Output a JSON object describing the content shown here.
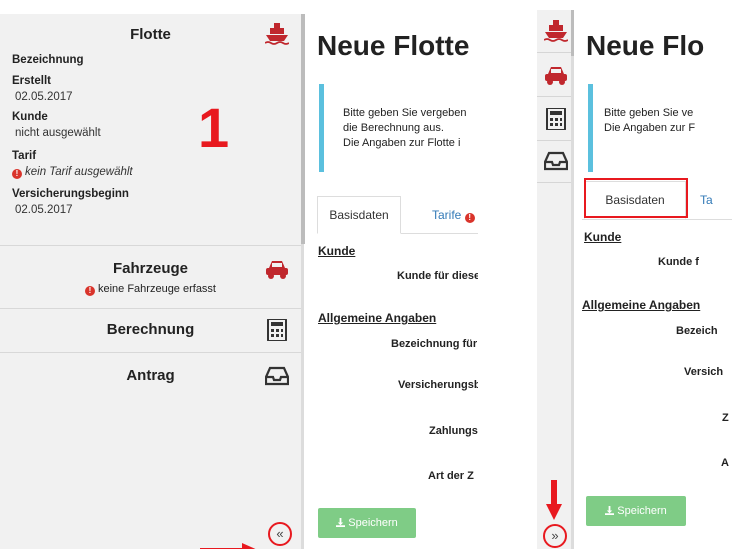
{
  "panel1": {
    "flotte": {
      "title": "Flotte",
      "icon": "ship-icon",
      "bezeichnung_label": "Bezeichnung",
      "erstellt_label": "Erstellt",
      "erstellt_value": "02.05.2017",
      "kunde_label": "Kunde",
      "kunde_value": "nicht ausgewählt",
      "tarif_label": "Tarif",
      "tarif_value": "kein Tarif ausgewählt",
      "vb_label": "Versicherungsbeginn",
      "vb_value": "02.05.2017"
    },
    "annotation_number": "1",
    "fahrzeuge": {
      "title": "Fahrzeuge",
      "warning": "keine Fahrzeuge erfasst",
      "icon": "car-icon"
    },
    "berechnung": {
      "title": "Berechnung",
      "icon": "calculator-icon"
    },
    "antrag": {
      "title": "Antrag",
      "icon": "inbox-icon"
    },
    "collapse_glyph": "«"
  },
  "content": {
    "page_title": "Neue Flotte",
    "info_line1": "Bitte geben Sie vergeben",
    "info_line2": "die Berechnung aus.",
    "info_line3": "Die Angaben zur Flotte i",
    "tab_basis": "Basisdaten",
    "tab_tarife": "Tarife",
    "section_kunde": "Kunde",
    "label_kunde": "Kunde für diese",
    "section_allgemein": "Allgemeine Angaben",
    "label_bez": "Bezeichnung für",
    "label_vers": "Versicherungsb",
    "label_zahlung": "Zahlungs",
    "label_art": "Art der Z",
    "save": "Speichern"
  },
  "panel2": {
    "page_title": "Neue Flo",
    "info_line1": "Bitte geben Sie ve",
    "info_line2": "Die Angaben zur F",
    "tab_basis": "Basisdaten",
    "tab_tarife": "Ta",
    "section_kunde": "Kunde",
    "label_kunde": "Kunde f",
    "section_allgemein": "Allgemeine Angaben",
    "label_bez": "Bezeich",
    "label_vers": "Versich",
    "label_zahlung": "Z",
    "label_art": "A",
    "save": "Speichern",
    "expand_glyph": "»"
  },
  "colors": {
    "accent_red": "#e8191f",
    "info_border": "#5bc0de",
    "save_green": "#7fcc86",
    "tab_blue": "#337ab7"
  }
}
